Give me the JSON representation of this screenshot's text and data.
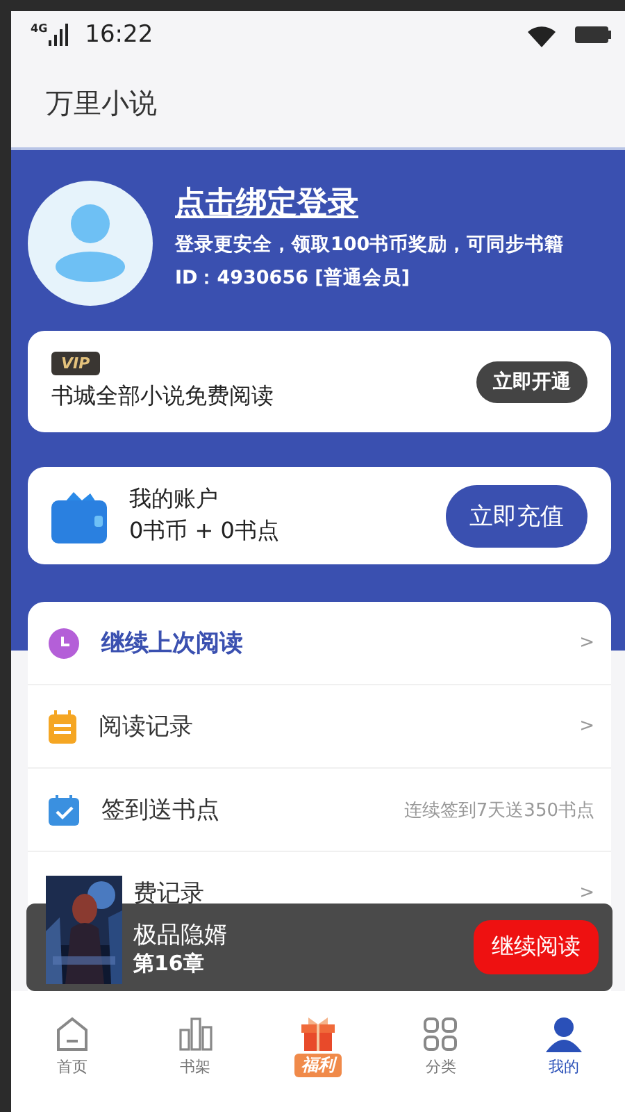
{
  "status_bar": {
    "network": "4G",
    "time": "16:22"
  },
  "header": {
    "title": "万里小说"
  },
  "profile": {
    "title": "点击绑定登录",
    "subtitle": "登录更安全，领取100书币奖励，可同步书籍",
    "id_line": "ID：4930656 [普通会员]"
  },
  "vip_card": {
    "badge": "VIP",
    "text": "书城全部小说免费阅读",
    "button": "立即开通"
  },
  "account_card": {
    "title": "我的账户",
    "balance": "0书币 + 0书点",
    "button": "立即充值"
  },
  "menu": [
    {
      "label": "继续上次阅读",
      "emphasis": true,
      "arrow": ">"
    },
    {
      "label": "阅读记录",
      "emphasis": false,
      "arrow": ">"
    },
    {
      "label": "签到送书点",
      "emphasis": false,
      "hint": "连续签到7天送350书点"
    },
    {
      "label": "费记录",
      "emphasis": false,
      "arrow": ">"
    }
  ],
  "reading_bar": {
    "title": "极品隐婿",
    "chapter": "第16章",
    "button": "继续阅读"
  },
  "tabs": [
    {
      "label": "首页",
      "kind": "normal",
      "selected": false
    },
    {
      "label": "书架",
      "kind": "normal",
      "selected": false
    },
    {
      "label": "福利",
      "kind": "promo",
      "selected": false
    },
    {
      "label": "分类",
      "kind": "normal",
      "selected": false
    },
    {
      "label": "我的",
      "kind": "normal",
      "selected": true
    }
  ]
}
